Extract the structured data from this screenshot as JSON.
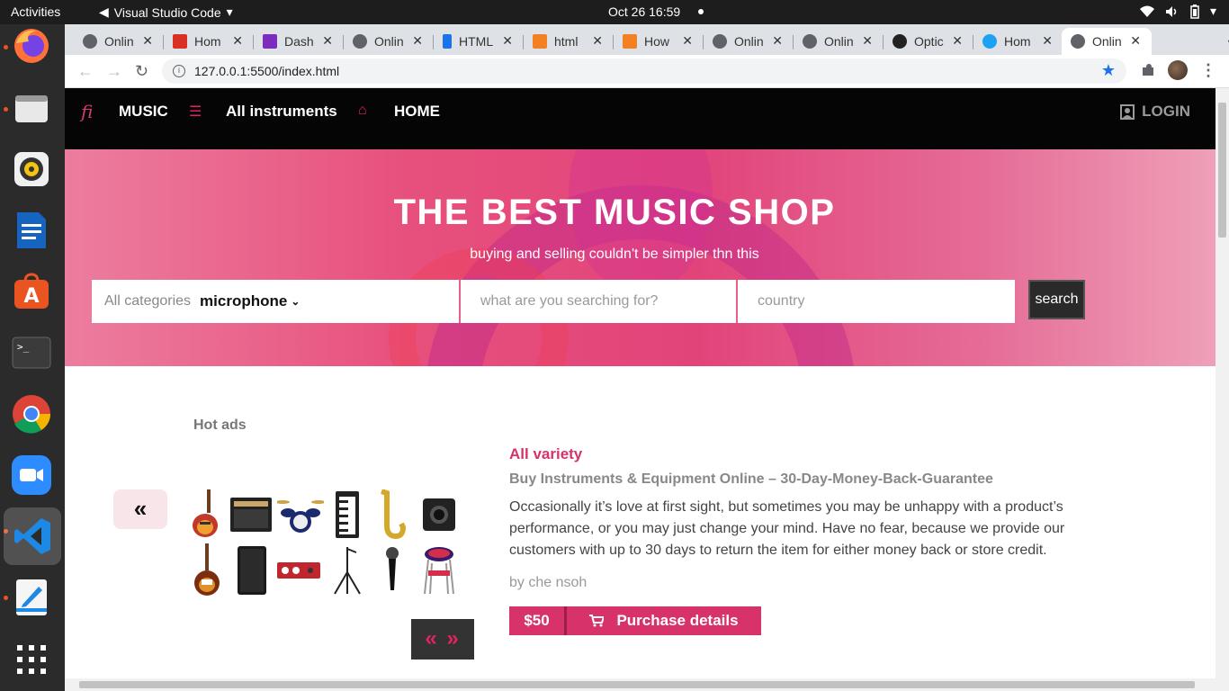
{
  "system": {
    "activities": "Activities",
    "app_name": "Visual Studio Code",
    "clock": "Oct 26  16:59"
  },
  "dock": {
    "items": [
      "firefox-icon",
      "files-icon",
      "rhythmbox-icon",
      "writer-icon",
      "software-icon",
      "terminal-icon",
      "chrome-icon",
      "zoom-icon",
      "vscode-icon",
      "text-editor-icon",
      "app-grid-icon"
    ]
  },
  "browser": {
    "tabs": [
      {
        "label": "Onlin",
        "color": "#5f6368"
      },
      {
        "label": "Hom",
        "color": "#d93025"
      },
      {
        "label": "Dash",
        "color": "#7b2cbf"
      },
      {
        "label": "Onlin",
        "color": "#5f6368"
      },
      {
        "label": "HTML",
        "color": "#1a73e8"
      },
      {
        "label": "html",
        "color": "#f48024"
      },
      {
        "label": "How",
        "color": "#f48024"
      },
      {
        "label": "Onlin",
        "color": "#5f6368"
      },
      {
        "label": "Onlin",
        "color": "#5f6368"
      },
      {
        "label": "Optic",
        "color": "#222222"
      },
      {
        "label": "Hom",
        "color": "#1da1f2"
      },
      {
        "label": "Onlin",
        "color": "#5f6368"
      }
    ],
    "url": "127.0.0.1:5500/index.html"
  },
  "site": {
    "logo": "fi",
    "nav": {
      "music": "MUSIC",
      "instruments": "All instruments",
      "home": "HOME",
      "login": "LOGIN"
    },
    "hero": {
      "title": "THE BEST MUSIC SHOP",
      "subtitle": "buying and selling couldn't be simpler thn this"
    },
    "search": {
      "category_label": "All categories",
      "category_value": "microphone",
      "query_placeholder": "what are you searching for?",
      "country_placeholder": "country",
      "button": "search"
    },
    "hot_ads": "Hot ads",
    "prev": "«",
    "pager": "« »",
    "ad": {
      "variety": "All variety",
      "headline": "Buy Instruments & Equipment Online – 30-Day-Money-Back-Guarantee",
      "description": "Occasionally it’s love at first sight, but sometimes you may be unhappy with a product’s performance, or you may just change your mind. Have no fear, because we provide our customers with up to 30 days to return the item for either money back or store credit.",
      "author": "by che nsoh",
      "price": "$50",
      "purchase": "Purchase details"
    },
    "products": [
      "electric-guitar",
      "amplifier",
      "drum-kit",
      "keyboard",
      "saxophone",
      "action-camera",
      "bass-guitar",
      "speaker",
      "audio-interface",
      "mic-stand",
      "microphone",
      "stool"
    ],
    "colors": {
      "accent": "#d8326a",
      "nav_bg": "#050505"
    }
  }
}
